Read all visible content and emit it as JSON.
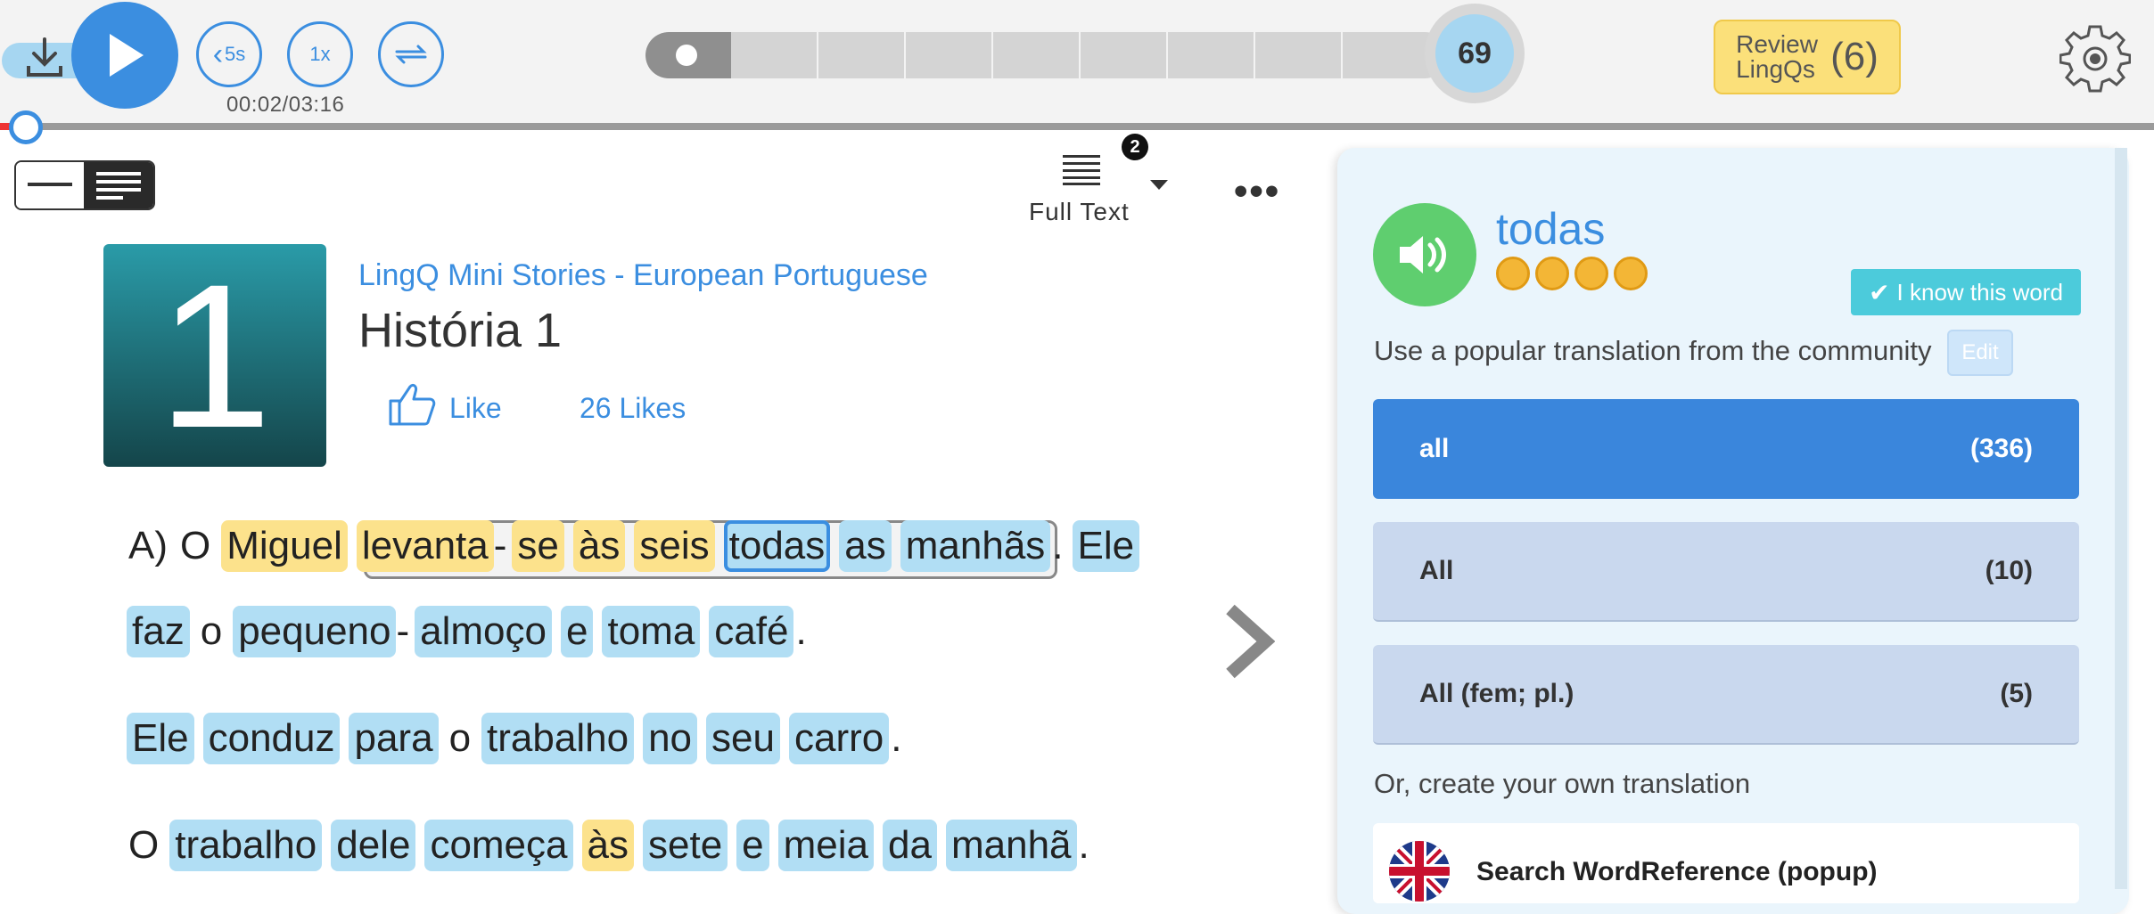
{
  "player": {
    "skip_back_label": "5s",
    "speed_label": "1x",
    "time": "00:02/03:16",
    "level_value": "69",
    "review_label": "Review LingQs",
    "review_count": "(6)"
  },
  "toolbar": {
    "full_text_label": "Full Text",
    "notification_count": "2",
    "more_label": "•••"
  },
  "lesson": {
    "thumb_number": "1",
    "course": "LingQ Mini Stories - European Portuguese",
    "title": "História 1",
    "like_label": "Like",
    "likes_count": "26 Likes"
  },
  "reader": {
    "lines": [
      [
        {
          "t": "A)",
          "k": "plain"
        },
        {
          "t": "O",
          "k": "plain"
        },
        {
          "t": "Miguel",
          "k": "yellow"
        },
        {
          "t": "levanta",
          "k": "yellow"
        },
        {
          "t": "-",
          "k": "dash"
        },
        {
          "t": "se",
          "k": "yellow"
        },
        {
          "t": "às",
          "k": "yellow"
        },
        {
          "t": "seis",
          "k": "yellow"
        },
        {
          "t": "todas",
          "k": "blue sel"
        },
        {
          "t": "as",
          "k": "blue"
        },
        {
          "t": "manhãs",
          "k": "blue"
        },
        {
          "t": ".",
          "k": "punct"
        },
        {
          "t": "Ele",
          "k": "blue"
        }
      ],
      [
        {
          "t": "faz",
          "k": "blue"
        },
        {
          "t": "o",
          "k": "plain"
        },
        {
          "t": "pequeno",
          "k": "blue"
        },
        {
          "t": "-",
          "k": "dash"
        },
        {
          "t": "almoço",
          "k": "blue"
        },
        {
          "t": "e",
          "k": "blue"
        },
        {
          "t": "toma",
          "k": "blue"
        },
        {
          "t": "café",
          "k": "blue"
        },
        {
          "t": ".",
          "k": "punct"
        }
      ],
      [
        {
          "t": "Ele",
          "k": "blue"
        },
        {
          "t": "conduz",
          "k": "blue"
        },
        {
          "t": "para",
          "k": "blue"
        },
        {
          "t": "o",
          "k": "plain"
        },
        {
          "t": "trabalho",
          "k": "blue"
        },
        {
          "t": "no",
          "k": "blue"
        },
        {
          "t": "seu",
          "k": "blue"
        },
        {
          "t": "carro",
          "k": "blue"
        },
        {
          "t": ".",
          "k": "punct"
        }
      ],
      [
        {
          "t": "O",
          "k": "plain"
        },
        {
          "t": "trabalho",
          "k": "blue"
        },
        {
          "t": "dele",
          "k": "blue"
        },
        {
          "t": "começa",
          "k": "blue"
        },
        {
          "t": "às",
          "k": "yellow"
        },
        {
          "t": "sete",
          "k": "blue"
        },
        {
          "t": "e",
          "k": "blue"
        },
        {
          "t": "meia",
          "k": "blue"
        },
        {
          "t": "da",
          "k": "blue"
        },
        {
          "t": "manhã",
          "k": "blue"
        },
        {
          "t": ".",
          "k": "punct"
        }
      ]
    ]
  },
  "panel": {
    "term": "todas",
    "know_label": "I know this word",
    "popular_label": "Use a popular translation from the community",
    "edit_label": "Edit",
    "hints": [
      {
        "text": "all",
        "count": "(336)",
        "active": true
      },
      {
        "text": "All",
        "count": "(10)",
        "active": false
      },
      {
        "text": "All (fem; pl.)",
        "count": "(5)",
        "active": false
      }
    ],
    "own_label": "Or, create your own translation",
    "wordref_label": "Search WordReference (popup)"
  },
  "colors": {
    "accent": "#3b8ee0",
    "known_yellow": "#fce28c",
    "new_blue": "#b1def4",
    "speaker_green": "#5fce6f"
  }
}
